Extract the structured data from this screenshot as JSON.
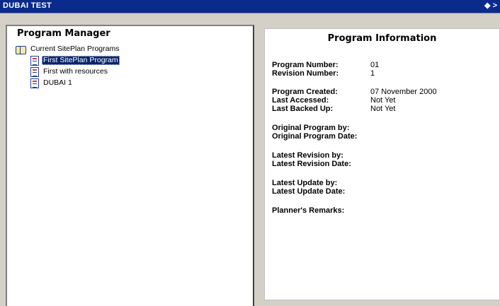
{
  "window": {
    "title": "DUBAI TEST",
    "control": "◆ >"
  },
  "program_manager": {
    "title": "Program Manager",
    "root_label": "Current SitePlan Programs",
    "programs": [
      {
        "label": "First SitePlan Program",
        "selected": true
      },
      {
        "label": "First with resources",
        "selected": false
      },
      {
        "label": "DUBAI 1",
        "selected": false
      }
    ]
  },
  "program_information": {
    "title": "Program Information",
    "fields": {
      "program_number": {
        "label": "Program Number:",
        "value": "01"
      },
      "revision_number": {
        "label": "Revision Number:",
        "value": "1"
      },
      "program_created": {
        "label": "Program Created:",
        "value": "07 November 2000"
      },
      "last_accessed": {
        "label": "Last Accessed:",
        "value": "Not Yet"
      },
      "last_backed_up": {
        "label": "Last Backed Up:",
        "value": "Not Yet"
      },
      "original_by": {
        "label": "Original Program by:",
        "value": ""
      },
      "original_date": {
        "label": "Original Program Date:",
        "value": ""
      },
      "latest_rev_by": {
        "label": "Latest Revision by:",
        "value": ""
      },
      "latest_rev_date": {
        "label": "Latest Revision Date:",
        "value": ""
      },
      "latest_update_by": {
        "label": "Latest Update by:",
        "value": ""
      },
      "latest_update_date": {
        "label": "Latest Update Date:",
        "value": ""
      },
      "remarks": {
        "label": "Planner's Remarks:",
        "value": ""
      }
    }
  }
}
